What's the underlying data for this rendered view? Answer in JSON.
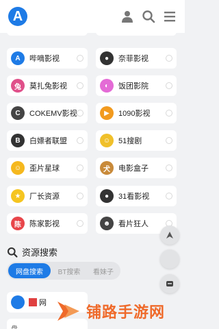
{
  "header": {
    "logo_letter": "A",
    "icons": [
      "user-icon",
      "search-icon",
      "menu-icon"
    ]
  },
  "sites": [
    {
      "label": "哔嘀影视",
      "icon": "letter-a-icon",
      "color": "#1e7be6",
      "glyph": "A"
    },
    {
      "label": "奈菲影视",
      "icon": "globe-icon",
      "color": "#333333",
      "glyph": "●"
    },
    {
      "label": "莫扎兔影视",
      "icon": "rabbit-icon",
      "color": "#e0508a",
      "glyph": "兔"
    },
    {
      "label": "饭团影院",
      "icon": "rice-ball-icon",
      "color": "#e46bd6",
      "glyph": "◐"
    },
    {
      "label": "COKEMV影视",
      "icon": "coke-icon",
      "color": "#444444",
      "glyph": "C"
    },
    {
      "label": "1090影视",
      "icon": "play-icon",
      "color": "#f29a1e",
      "glyph": "▶"
    },
    {
      "label": "白嫖者联盟",
      "icon": "b-icon",
      "color": "#333333",
      "glyph": "B"
    },
    {
      "label": "51搜剧",
      "icon": "mascot-icon",
      "color": "#f0c02a",
      "glyph": "☺"
    },
    {
      "label": "歪片星球",
      "icon": "smile-icon",
      "color": "#f5b81e",
      "glyph": "☺"
    },
    {
      "label": "电影盒子",
      "icon": "dog-icon",
      "color": "#c88a3a",
      "glyph": "犬"
    },
    {
      "label": "厂长资源",
      "icon": "factory-icon",
      "color": "#f5c520",
      "glyph": "★"
    },
    {
      "label": "31看影视",
      "icon": "globe-icon",
      "color": "#333333",
      "glyph": "●"
    },
    {
      "label": "陈家影视",
      "icon": "chen-icon",
      "color": "#e8454a",
      "glyph": "陈"
    },
    {
      "label": "看片狂人",
      "icon": "face-icon",
      "color": "#444444",
      "glyph": "☻"
    }
  ],
  "search_section": {
    "title": "资源搜索",
    "tabs": [
      "网盘搜索",
      "BT搜索",
      "看妹子"
    ],
    "active_tab": 0
  },
  "result": {
    "label": "网",
    "label2": "盘"
  },
  "fabs": [
    "up-arrow-icon",
    "circle-icon",
    "tv-icon"
  ],
  "watermark": {
    "text": "铺路手游网"
  }
}
